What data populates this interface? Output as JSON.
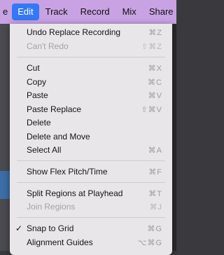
{
  "menubar": {
    "items": [
      "e",
      "Edit",
      "Track",
      "Record",
      "Mix",
      "Share"
    ]
  },
  "edit_menu": {
    "items": [
      {
        "label": "Undo Replace Recording",
        "shortcut": "⌘Z",
        "enabled": true
      },
      {
        "label": "Can't Redo",
        "shortcut": "⇧⌘Z",
        "enabled": false
      },
      {
        "label": "Cut",
        "shortcut": "⌘X",
        "enabled": true
      },
      {
        "label": "Copy",
        "shortcut": "⌘C",
        "enabled": true
      },
      {
        "label": "Paste",
        "shortcut": "⌘V",
        "enabled": true
      },
      {
        "label": "Paste Replace",
        "shortcut": "⇧⌘V",
        "enabled": true
      },
      {
        "label": "Delete",
        "shortcut": "",
        "enabled": true
      },
      {
        "label": "Delete and Move",
        "shortcut": "",
        "enabled": true
      },
      {
        "label": "Select All",
        "shortcut": "⌘A",
        "enabled": true
      },
      {
        "label": "Show Flex Pitch/Time",
        "shortcut": "⌘F",
        "enabled": true
      },
      {
        "label": "Split Regions at Playhead",
        "shortcut": "⌘T",
        "enabled": true
      },
      {
        "label": "Join Regions",
        "shortcut": "⌘J",
        "enabled": false
      },
      {
        "label": "Snap to Grid",
        "shortcut": "⌘G",
        "enabled": true,
        "checked": true,
        "check_mark": "✓"
      },
      {
        "label": "Alignment Guides",
        "shortcut": "⌥⌘G",
        "enabled": true
      }
    ]
  },
  "colors": {
    "menubar_bg": "#c9a2e4",
    "active_highlight": "#3478f6",
    "menu_bg": "#e9e6ea",
    "disabled_text": "#a3a3a3"
  }
}
